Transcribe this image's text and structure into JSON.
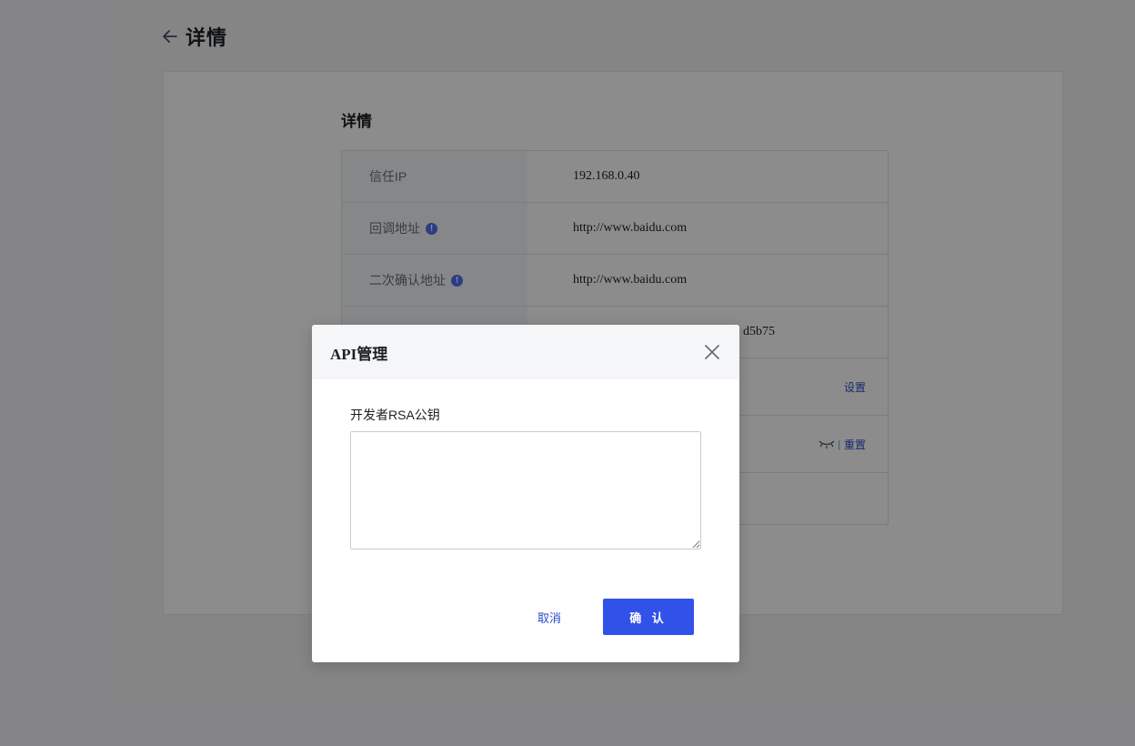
{
  "header": {
    "title": "详情",
    "back_icon": "arrow-left-icon"
  },
  "details": {
    "section_title": "详情",
    "rows": [
      {
        "label": "信任IP",
        "value": "192.168.0.40",
        "info": false
      },
      {
        "label": "回调地址",
        "value": "http://www.baidu.com",
        "info": true
      },
      {
        "label": "二次确认地址",
        "value": "http://www.baidu.com",
        "info": true
      },
      {
        "label": "",
        "value": "d5b75"
      }
    ],
    "set_link": "设置",
    "reset_link": "重置",
    "separator": "|"
  },
  "modal": {
    "title": "API管理",
    "field_label": "开发者RSA公钥",
    "textarea_value": "",
    "cancel_label": "取消",
    "confirm_label": "确 认"
  },
  "colors": {
    "accent": "#3152e8",
    "link": "#2b4acb",
    "overlay": "rgba(0,0,0,0.45)"
  }
}
